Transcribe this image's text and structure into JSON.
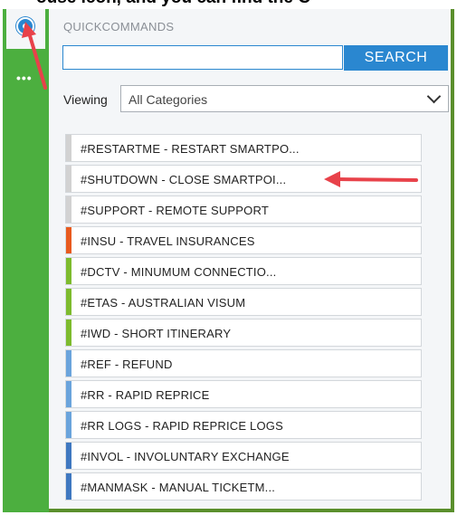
{
  "panel": {
    "title": "QUICKCOMMANDS",
    "search_placeholder": "",
    "search_button_label": "SEARCH",
    "viewing_label": "Viewing",
    "viewing_selected": "All Categories"
  },
  "sidebar": {
    "more_label": "•••"
  },
  "colors": {
    "accent": "#2a87d0",
    "sidebar_green": "#4caf3f",
    "annotation_red": "#e8424a"
  },
  "commands": [
    {
      "label": "#RESTARTME - RESTART SMARTPO...",
      "color": "#d2d2d2"
    },
    {
      "label": "#SHUTDOWN - CLOSE SMARTPOI...",
      "color": "#d2d2d2"
    },
    {
      "label": "#SUPPORT - REMOTE SUPPORT",
      "color": "#d2d2d2"
    },
    {
      "label": "#INSU - TRAVEL INSURANCES",
      "color": "#e85a1e"
    },
    {
      "label": "#DCTV - MINUMUM CONNECTIO...",
      "color": "#7dbb2d"
    },
    {
      "label": "#ETAS - AUSTRALIAN VISUM",
      "color": "#7dbb2d"
    },
    {
      "label": "#IWD - SHORT ITINERARY",
      "color": "#7dbb2d"
    },
    {
      "label": "#REF - REFUND",
      "color": "#6aa4dc"
    },
    {
      "label": "#RR - RAPID REPRICE",
      "color": "#6aa4dc"
    },
    {
      "label": "#RR LOGS - RAPID REPRICE LOGS",
      "color": "#6aa4dc"
    },
    {
      "label": "#INVOL - INVOLUNTARY EXCHANGE",
      "color": "#3f78c0"
    },
    {
      "label": "#MANMASK - MANUAL TICKETM...",
      "color": "#3f78c0"
    }
  ]
}
